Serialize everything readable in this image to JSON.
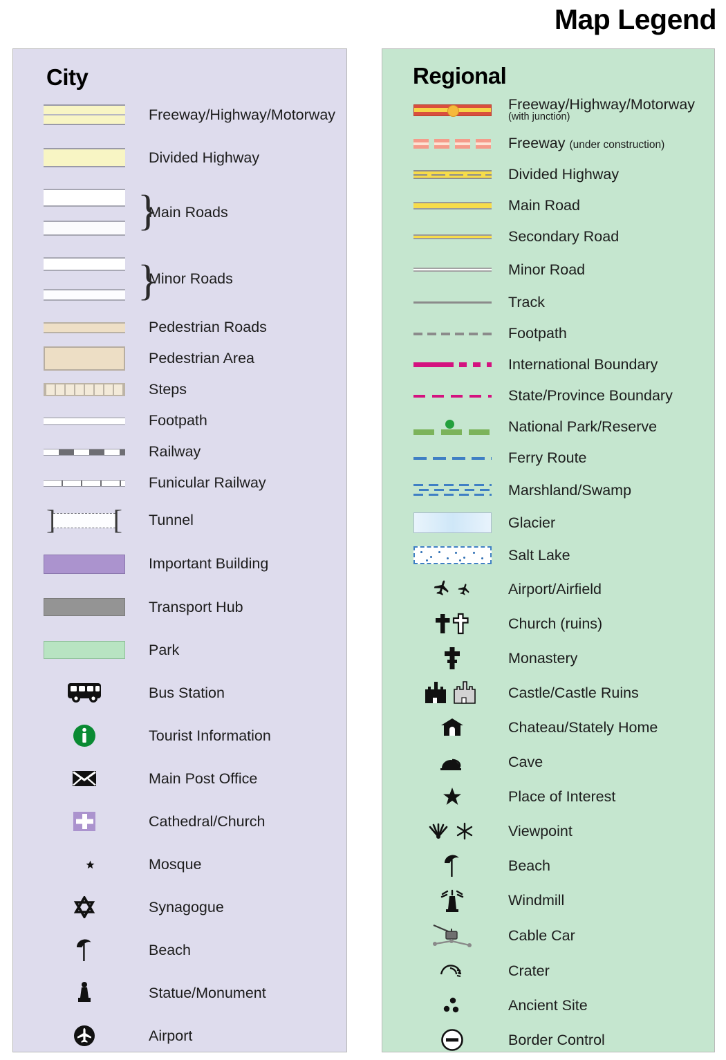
{
  "title": "Map Legend",
  "city": {
    "heading": "City",
    "bg_color": "#dedced",
    "items": [
      {
        "label": "Freeway/Highway/Motorway",
        "symbol": "freeway-double-band"
      },
      {
        "label": "Divided Highway",
        "symbol": "divided-highway-band"
      },
      {
        "label": "Main Roads",
        "symbol": "main-roads-bracket-pair"
      },
      {
        "label": "Minor Roads",
        "symbol": "minor-roads-bracket-pair"
      },
      {
        "label": "Pedestrian Roads",
        "symbol": "pedestrian-road-band"
      },
      {
        "label": "Pedestrian Area",
        "symbol": "pedestrian-area-block"
      },
      {
        "label": "Steps",
        "symbol": "steps-hatched-band"
      },
      {
        "label": "Footpath",
        "symbol": "footpath-thin-band"
      },
      {
        "label": "Railway",
        "symbol": "railway-dashed-band"
      },
      {
        "label": "Funicular Railway",
        "symbol": "funicular-ticked-band"
      },
      {
        "label": "Tunnel",
        "symbol": "tunnel-dashed-brackets"
      },
      {
        "label": "Important Building",
        "symbol": "important-building-swatch"
      },
      {
        "label": "Transport Hub",
        "symbol": "transport-hub-swatch"
      },
      {
        "label": "Park",
        "symbol": "park-swatch"
      },
      {
        "label": "Bus Station",
        "symbol": "bus-icon"
      },
      {
        "label": "Tourist Information",
        "symbol": "tourist-information-icon"
      },
      {
        "label": "Main Post Office",
        "symbol": "envelope-icon"
      },
      {
        "label": "Cathedral/Church",
        "symbol": "cross-square-icon"
      },
      {
        "label": "Mosque",
        "symbol": "crescent-star-icon"
      },
      {
        "label": "Synagogue",
        "symbol": "star-of-david-icon"
      },
      {
        "label": "Beach",
        "symbol": "beach-parasol-icon"
      },
      {
        "label": "Statue/Monument",
        "symbol": "statue-icon"
      },
      {
        "label": "Airport",
        "symbol": "airplane-circle-icon"
      }
    ]
  },
  "regional": {
    "heading": "Regional",
    "bg_color": "#c5e6cf",
    "items": [
      {
        "label": "Freeway/Highway/Motorway",
        "sub": "(with junction)",
        "symbol": "freeway-red-junction"
      },
      {
        "label": "Freeway",
        "sub_inline": "(under construction)",
        "symbol": "freeway-under-construction"
      },
      {
        "label": "Divided Highway",
        "symbol": "divided-highway-yellow"
      },
      {
        "label": "Main Road",
        "symbol": "main-road-yellow"
      },
      {
        "label": "Secondary Road",
        "symbol": "secondary-road-yellow"
      },
      {
        "label": "Minor Road",
        "symbol": "minor-road-white"
      },
      {
        "label": "Track",
        "symbol": "track-grey-line"
      },
      {
        "label": "Footpath",
        "symbol": "footpath-dashed-grey"
      },
      {
        "label": "International Boundary",
        "symbol": "international-boundary-magenta"
      },
      {
        "label": "State/Province Boundary",
        "symbol": "state-boundary-dashed-magenta"
      },
      {
        "label": "National Park/Reserve",
        "symbol": "national-park-green-dash-dot"
      },
      {
        "label": "Ferry Route",
        "symbol": "ferry-route-blue-dashed"
      },
      {
        "label": "Marshland/Swamp",
        "symbol": "marshland-blue-hatch"
      },
      {
        "label": "Glacier",
        "symbol": "glacier-gradient-swatch"
      },
      {
        "label": "Salt Lake",
        "symbol": "salt-lake-dotted-swatch"
      },
      {
        "label": "Airport/Airfield",
        "symbol": "airplane-pair-icon"
      },
      {
        "label": "Church (ruins)",
        "symbol": "cross-pair-icon"
      },
      {
        "label": "Monastery",
        "symbol": "monastery-cross-icon"
      },
      {
        "label": "Castle/Castle Ruins",
        "symbol": "castle-pair-icon"
      },
      {
        "label": "Chateau/Stately Home",
        "symbol": "chateau-icon"
      },
      {
        "label": "Cave",
        "symbol": "cave-icon"
      },
      {
        "label": "Place of Interest",
        "symbol": "star-icon"
      },
      {
        "label": "Viewpoint",
        "symbol": "viewpoint-pair-icon"
      },
      {
        "label": "Beach",
        "symbol": "beach-parasol-icon"
      },
      {
        "label": "Windmill",
        "symbol": "windmill-icon"
      },
      {
        "label": "Cable Car",
        "symbol": "cable-car-icon"
      },
      {
        "label": "Crater",
        "symbol": "crater-icon"
      },
      {
        "label": "Ancient Site",
        "symbol": "ancient-site-dots-icon"
      },
      {
        "label": "Border Control",
        "symbol": "border-control-icon"
      }
    ]
  }
}
